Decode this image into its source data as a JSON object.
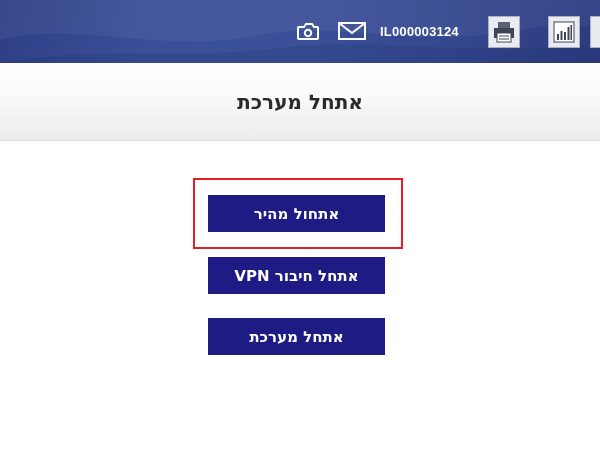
{
  "header": {
    "user_id": "IL000003124",
    "icons": [
      "camera-icon",
      "mail-icon",
      "printer-icon",
      "bar-chart-icon"
    ]
  },
  "page": {
    "title": "אתחל מערכת"
  },
  "actions": {
    "quick_restart": "אתחול מהיר",
    "vpn_restart": "אתחל חיבור VPN",
    "system_restart": "אתחל מערכת"
  },
  "colors": {
    "topbar": "#34478f",
    "button": "#1f1b85",
    "highlight": "#e31e24"
  }
}
